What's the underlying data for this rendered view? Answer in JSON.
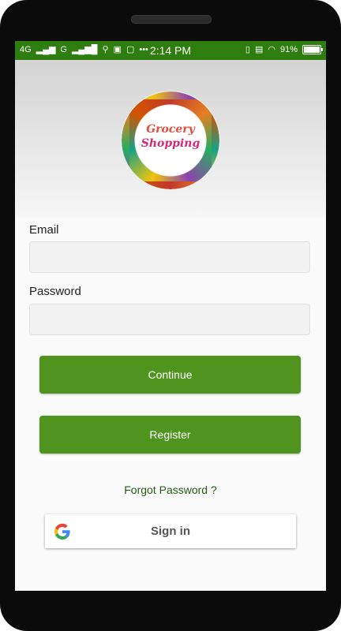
{
  "statusbar": {
    "left": "4G",
    "left_extra": "G",
    "time": "2:14 PM",
    "battery": "91%",
    "right_icons": [
      "vibrate-icon",
      "volte-icon",
      "wifi-icon"
    ]
  },
  "app": {
    "logo_line1": "Grocery",
    "logo_line2": "Shopping"
  },
  "form": {
    "email_label": "Email",
    "email_value": "",
    "password_label": "Password",
    "password_value": ""
  },
  "buttons": {
    "continue": "Continue",
    "register": "Register",
    "forgot": "Forgot Password ?",
    "google_signin": "Sign in"
  }
}
